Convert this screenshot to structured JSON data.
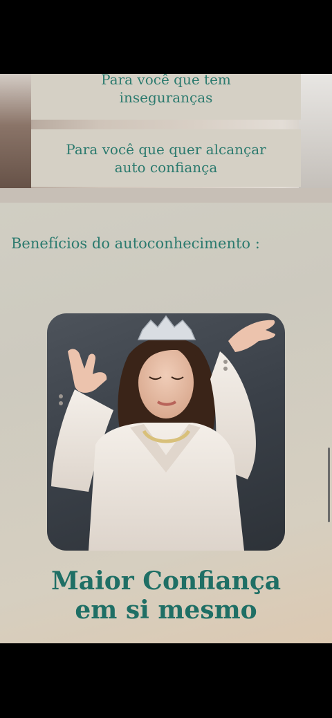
{
  "hero": {
    "card1_line1": "Para você que tem",
    "card1_line2": "inseguranças",
    "card2_line1": "Para você que quer alcançar",
    "card2_line2": "auto confiança"
  },
  "section": {
    "title": "Benefícios do autoconhecimento :"
  },
  "feature": {
    "image_icon": "woman-with-tiara-photo",
    "headline_line1": "Maior Confiança",
    "headline_line2": "em si mesmo"
  },
  "colors": {
    "accent": "#2b7a6e",
    "card_bg": "#d5d0c5",
    "page_bg": "#d1cfc4"
  }
}
